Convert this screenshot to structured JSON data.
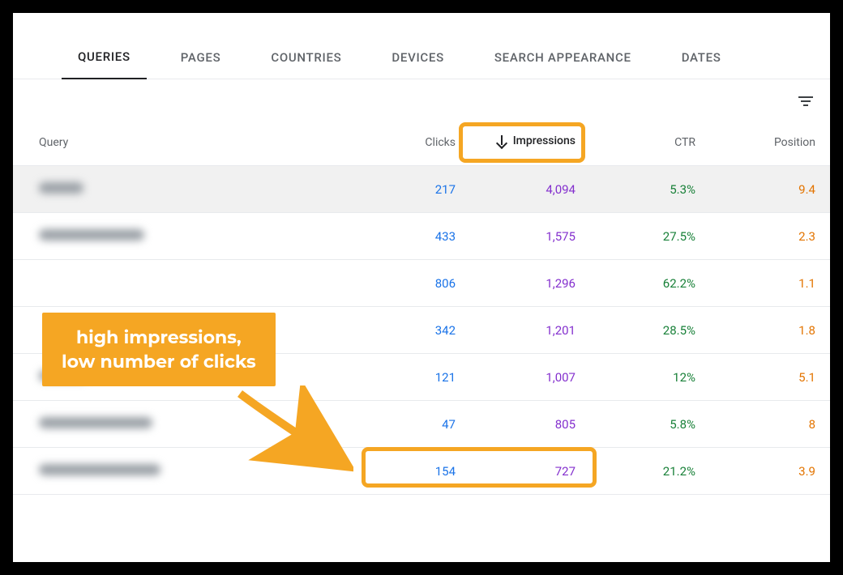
{
  "tabs": {
    "queries": "QUERIES",
    "pages": "PAGES",
    "countries": "COUNTRIES",
    "devices": "DEVICES",
    "search_appearance": "SEARCH APPEARANCE",
    "dates": "DATES"
  },
  "columns": {
    "query": "Query",
    "clicks": "Clicks",
    "impressions": "Impressions",
    "ctr": "CTR",
    "position": "Position"
  },
  "rows": [
    {
      "clicks": "217",
      "impressions": "4,094",
      "ctr": "5.3%",
      "position": "9.4",
      "qwidth": 55,
      "highlighted": true
    },
    {
      "clicks": "433",
      "impressions": "1,575",
      "ctr": "27.5%",
      "position": "2.3",
      "qwidth": 130
    },
    {
      "clicks": "806",
      "impressions": "1,296",
      "ctr": "62.2%",
      "position": "1.1",
      "qwidth": 0
    },
    {
      "clicks": "342",
      "impressions": "1,201",
      "ctr": "28.5%",
      "position": "1.8",
      "qwidth": 0
    },
    {
      "clicks": "121",
      "impressions": "1,007",
      "ctr": "12%",
      "position": "5.1",
      "qwidth": 60
    },
    {
      "clicks": "47",
      "impressions": "805",
      "ctr": "5.8%",
      "position": "8",
      "qwidth": 140
    },
    {
      "clicks": "154",
      "impressions": "727",
      "ctr": "21.2%",
      "position": "3.9",
      "qwidth": 150
    }
  ],
  "annotation": {
    "line1": "high impressions,",
    "line2": "low number of clicks"
  },
  "sorted_by": "impressions",
  "sort_direction": "desc"
}
